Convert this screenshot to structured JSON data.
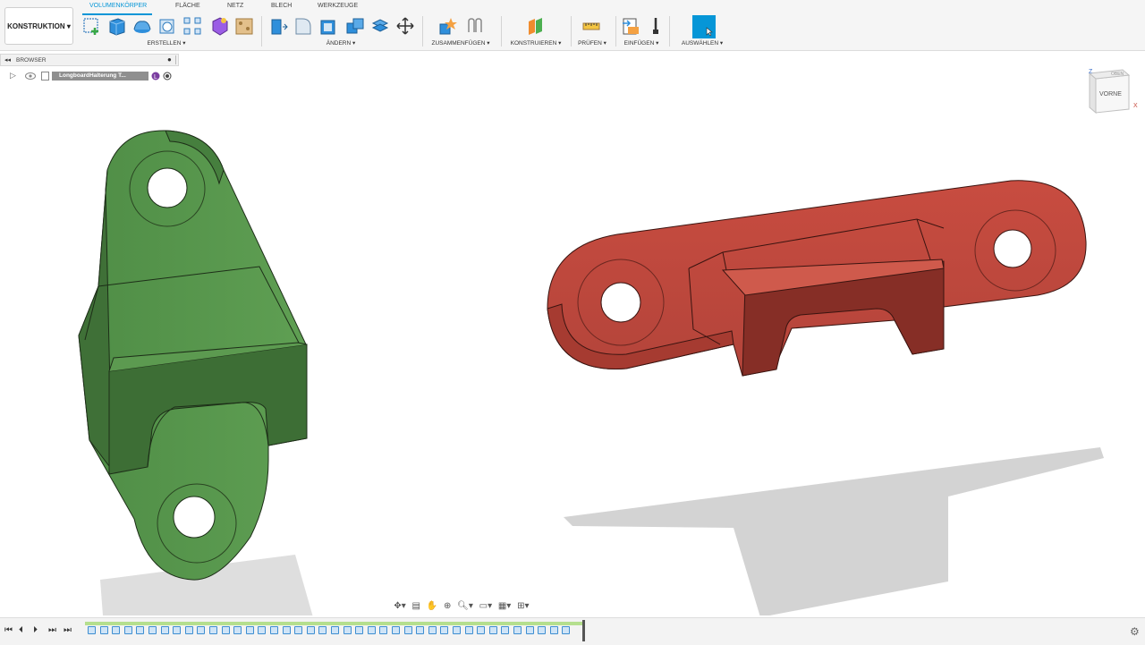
{
  "workspace": {
    "label": "KONSTRUKTION ▾"
  },
  "tabs": [
    {
      "label": "VOLUMENKÖRPER",
      "active": true
    },
    {
      "label": "FLÄCHE"
    },
    {
      "label": "NETZ"
    },
    {
      "label": "BLECH"
    },
    {
      "label": "WERKZEUGE"
    }
  ],
  "groups": {
    "erstellen": "ERSTELLEN ▾",
    "aendern": "ÄNDERN ▾",
    "zusammenfuegen": "ZUSAMMENFÜGEN ▾",
    "konstruieren": "KONSTRUIEREN ▾",
    "pruefen": "PRÜFEN ▾",
    "einfuegen": "EINFÜGEN ▾",
    "auswaehlen": "AUSWÄHLEN ▾"
  },
  "browser": {
    "title": "BROWSER",
    "doc_name": "LongboardHalterung T..."
  },
  "viewcube": {
    "top": "OBEN",
    "front": "VORNE",
    "axis_z": "Z",
    "axis_x": "X"
  },
  "colors": {
    "accent": "#0696d7",
    "green_part": "#4e8f45",
    "red_part": "#c2473c"
  },
  "icons": [
    "new-component-icon",
    "sketch-icon",
    "extrude-icon",
    "revolve-icon",
    "hole-icon",
    "pattern-icon",
    "form-icon",
    "insert-icon",
    "press-pull-icon",
    "fillet-icon",
    "shell-icon",
    "combine-icon",
    "align-icon",
    "move-icon",
    "new-joint-icon",
    "as-built-joint-icon",
    "offset-plane-icon",
    "measure-icon",
    "insert-derive-icon",
    "insert-mesh-icon",
    "select-icon"
  ],
  "timeline": {
    "controls": [
      "⏮",
      "⏴",
      "⏵",
      "⏭",
      "⏭"
    ],
    "feature_count": 40
  }
}
